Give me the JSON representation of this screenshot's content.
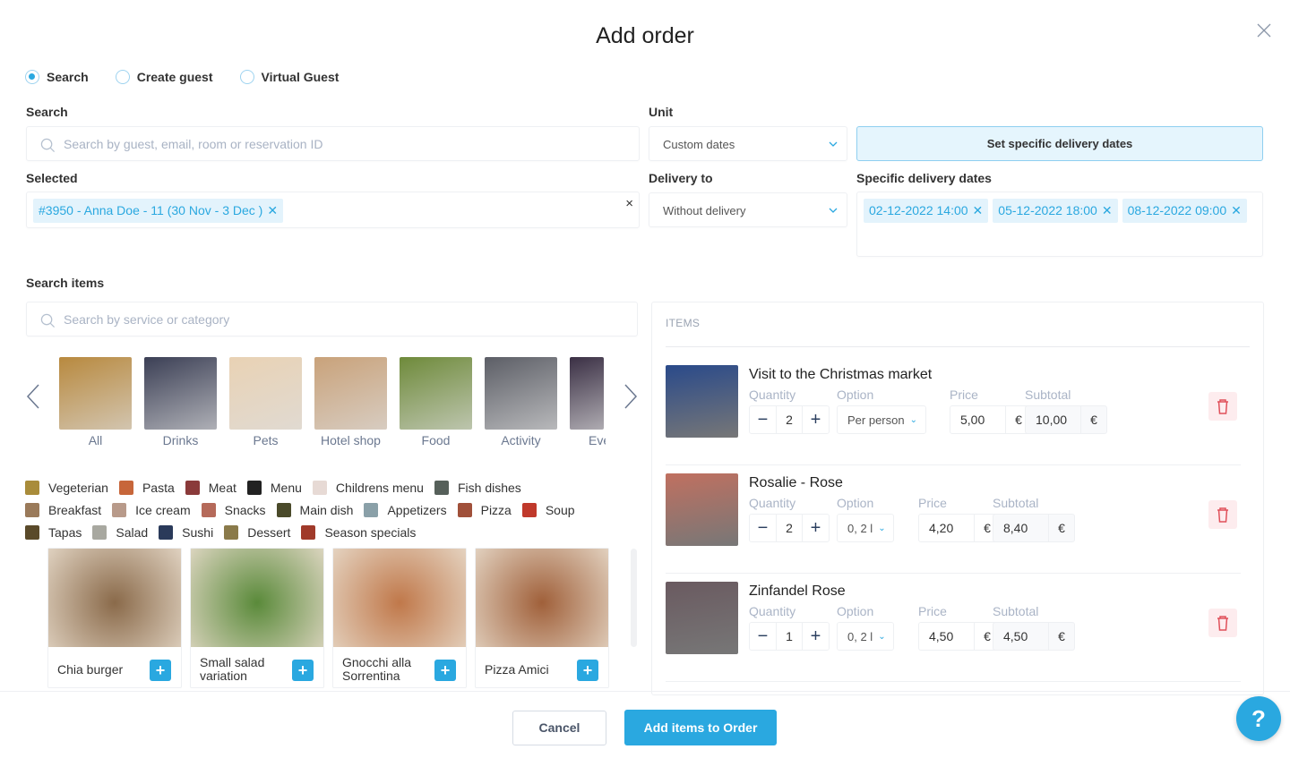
{
  "modal": {
    "title": "Add order",
    "close_icon": "close-icon"
  },
  "mode": {
    "options": [
      {
        "label": "Search",
        "selected": true
      },
      {
        "label": "Create guest",
        "selected": false
      },
      {
        "label": "Virtual Guest",
        "selected": false
      }
    ]
  },
  "guest": {
    "search_label": "Search",
    "search_placeholder": "Search by guest, email, room or reservation ID",
    "selected_label": "Selected",
    "selected_tag": "#3950 - Anna Doe - 11 (30 Nov - 3 Dec )",
    "clear_symbol": "×"
  },
  "unit": {
    "label": "Unit",
    "value": "Custom dates",
    "set_dates_button": "Set specific delivery dates"
  },
  "delivery": {
    "label": "Delivery to",
    "value": "Without delivery",
    "dates_label": "Specific delivery dates",
    "dates": [
      "02-12-2022 14:00",
      "05-12-2022 18:00",
      "08-12-2022 09:00"
    ]
  },
  "search_items": {
    "label": "Search items",
    "placeholder": "Search by service or category"
  },
  "categories": [
    {
      "label": "All",
      "color": "#b8893e"
    },
    {
      "label": "Drinks",
      "color": "#3b3f55"
    },
    {
      "label": "Pets",
      "color": "#e9d2b4"
    },
    {
      "label": "Hotel shop",
      "color": "#c9a27a"
    },
    {
      "label": "Food",
      "color": "#6e8a3a"
    },
    {
      "label": "Activity",
      "color": "#5c5e66"
    },
    {
      "label": "Eve",
      "color": "#3a2f44"
    }
  ],
  "subcategories": [
    {
      "label": "Vegeterian",
      "color": "#a98c3a"
    },
    {
      "label": "Pasta",
      "color": "#c7663a"
    },
    {
      "label": "Meat",
      "color": "#8a3a3a"
    },
    {
      "label": "Menu",
      "color": "#222222"
    },
    {
      "label": "Childrens menu",
      "color": "#e7dad5"
    },
    {
      "label": "Fish dishes",
      "color": "#56605a"
    },
    {
      "label": "Breakfast",
      "color": "#9a7a5a"
    },
    {
      "label": "Ice cream",
      "color": "#b89a8a"
    },
    {
      "label": "Snacks",
      "color": "#b56a5a"
    },
    {
      "label": "Main dish",
      "color": "#4a4a2a"
    },
    {
      "label": "Appetizers",
      "color": "#8aa0a8"
    },
    {
      "label": "Pizza",
      "color": "#a0503a"
    },
    {
      "label": "Soup",
      "color": "#c0392b"
    },
    {
      "label": "Tapas",
      "color": "#5a4a2a"
    },
    {
      "label": "Salad",
      "color": "#a8a8a0"
    },
    {
      "label": "Sushi",
      "color": "#2a3a5a"
    },
    {
      "label": "Dessert",
      "color": "#8a7a4a"
    },
    {
      "label": "Season specials",
      "color": "#a03a2a"
    }
  ],
  "products": [
    {
      "name": "Chia burger",
      "color": "#8a6a4a"
    },
    {
      "name": "Small salad variation",
      "color": "#5a8a3a"
    },
    {
      "name": "Gnocchi alla Sorrentina",
      "color": "#c0784a"
    },
    {
      "name": "Pizza Amici",
      "color": "#a0603a"
    }
  ],
  "order_items": {
    "header": "ITEMS",
    "col_quantity": "Quantity",
    "col_option": "Option",
    "col_price": "Price",
    "col_subtotal": "Subtotal",
    "currency": "€",
    "rows": [
      {
        "name": "Visit to the Christmas market",
        "quantity": "2",
        "option": "Per person",
        "price": "5,00",
        "subtotal": "10,00",
        "color": "#2a4a8a"
      },
      {
        "name": "Rosalie - Rose",
        "quantity": "2",
        "option": "0, 2 l",
        "price": "4,20",
        "subtotal": "8,40",
        "color": "#c07060"
      },
      {
        "name": "Zinfandel Rose",
        "quantity": "1",
        "option": "0, 2 l",
        "price": "4,50",
        "subtotal": "4,50",
        "color": "#6a5a60"
      }
    ]
  },
  "footer": {
    "cancel": "Cancel",
    "submit": "Add items to Order",
    "help": "?"
  },
  "colors": {
    "accent": "#2aa8e0",
    "danger": "#e0505a"
  }
}
